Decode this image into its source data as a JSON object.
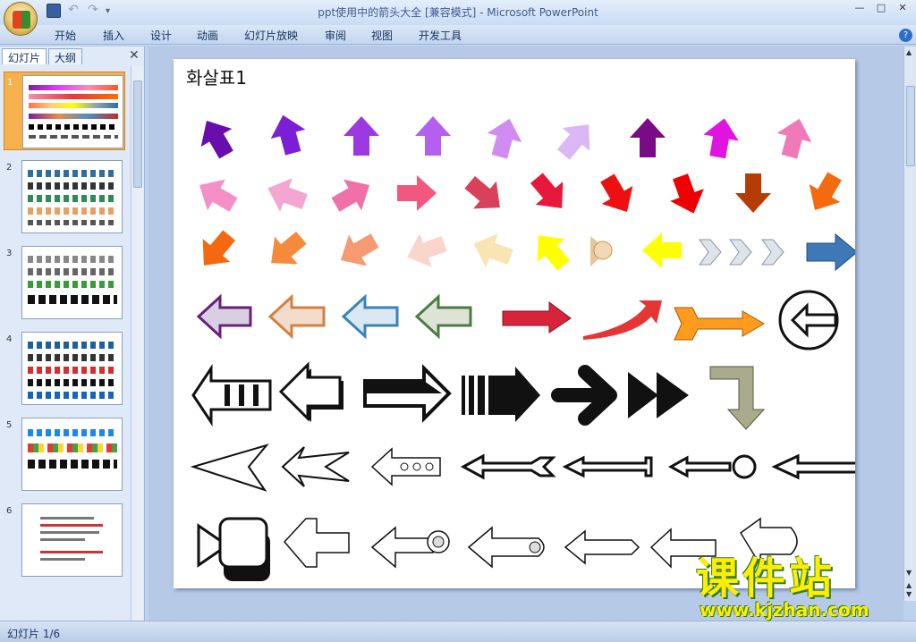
{
  "window": {
    "title": "ppt使用中的箭头大全 [兼容模式] - Microsoft PowerPoint",
    "controls": [
      "—",
      "□",
      "✕"
    ]
  },
  "quick_access": {
    "save": "save-icon",
    "undo": "↶",
    "redo": "↷",
    "more": "▾"
  },
  "menu": [
    "开始",
    "插入",
    "设计",
    "动画",
    "幻灯片放映",
    "审阅",
    "视图",
    "开发工具"
  ],
  "left_pane": {
    "tabs": [
      "幻灯片",
      "大纲"
    ],
    "close": "✕",
    "slides": [
      {
        "num": "1",
        "selected": true
      },
      {
        "num": "2"
      },
      {
        "num": "3"
      },
      {
        "num": "4"
      },
      {
        "num": "5"
      },
      {
        "num": "6"
      }
    ]
  },
  "slide": {
    "title": "화살표1"
  },
  "status": {
    "text": "幻灯片 1/6"
  },
  "watermark": {
    "text": "课件站",
    "url": "www.kjzhan.com"
  },
  "colors": {
    "accent": "#f6b04c",
    "ribbon": "#c3d6ef"
  }
}
